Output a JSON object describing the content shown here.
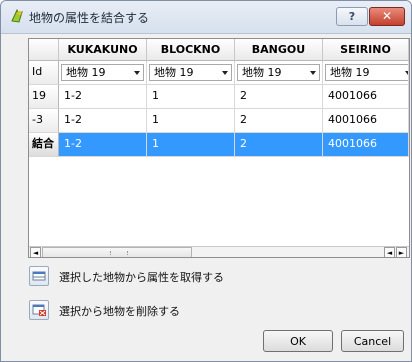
{
  "window": {
    "title": "地物の属性を結合する",
    "help_label": "?",
    "close_label": "✕"
  },
  "table": {
    "columns": [
      "KUKAKUNO",
      "BLOCKNO",
      "BANGOU",
      "SEIRINO"
    ],
    "id_row": {
      "label": "Id",
      "selectors": [
        "地物 19",
        "地物 19",
        "地物 19",
        "地物 19"
      ]
    },
    "rows": [
      {
        "id": "19",
        "values": [
          "1-2",
          "1",
          "2",
          "4001066"
        ]
      },
      {
        "id": "-3",
        "values": [
          "1-2",
          "1",
          "2",
          "4001066"
        ]
      }
    ],
    "merge_row": {
      "label": "結合",
      "values": [
        "1-2",
        "1",
        "2",
        "4001066"
      ]
    },
    "scroll": {
      "left": "◄",
      "right_a": "◄",
      "right_b": "►"
    }
  },
  "actions": {
    "take_attributes": "選択した地物から属性を取得する",
    "remove_feature": "選択から地物を削除する"
  },
  "buttons": {
    "ok": "OK",
    "cancel": "Cancel"
  },
  "colors": {
    "selection": "#3399ff",
    "title_bar": "#dbe4f0"
  }
}
